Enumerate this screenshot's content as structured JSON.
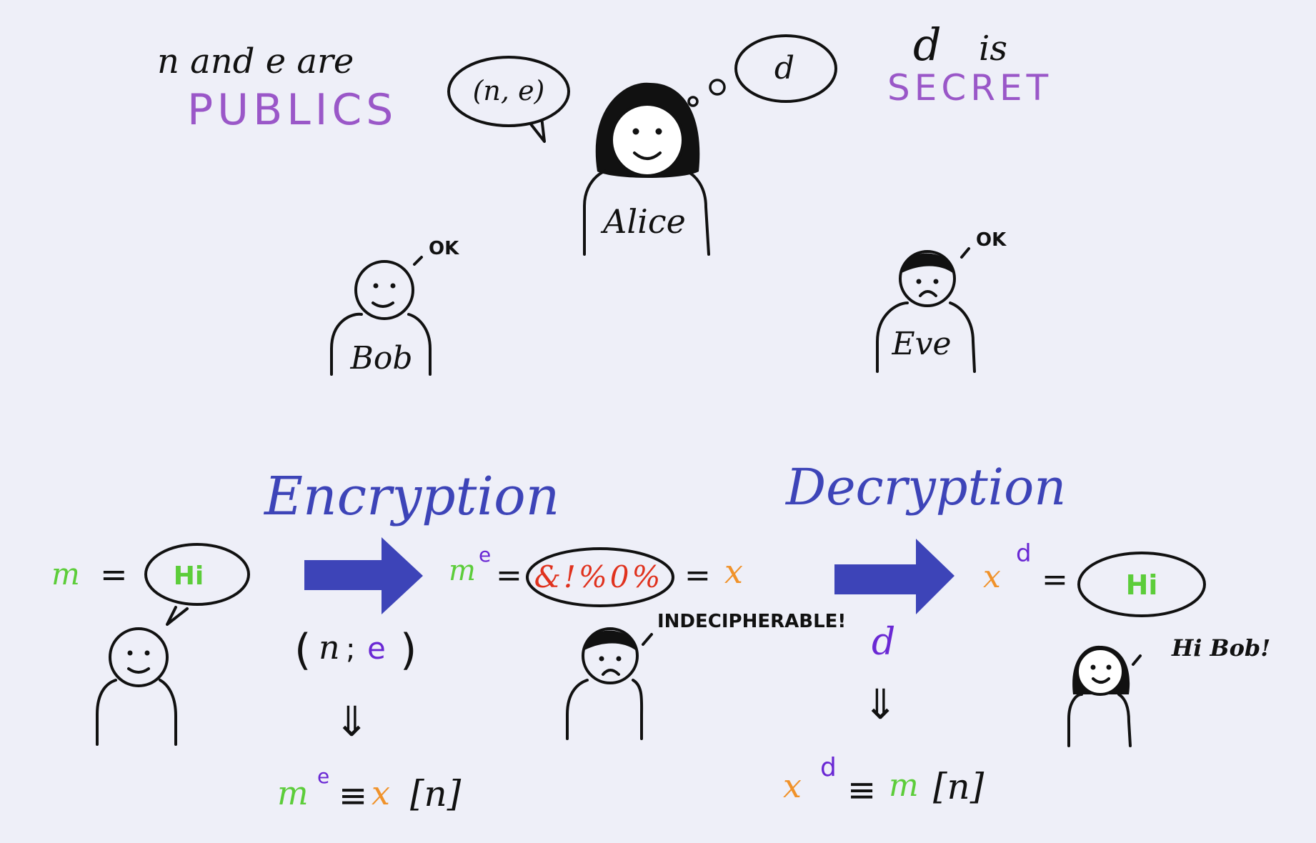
{
  "colors": {
    "ink": "#111111",
    "purple": "#9a57c8",
    "blue": "#3d44b8",
    "green": "#5ccd3a",
    "orange": "#f0922a",
    "red": "#e0321e",
    "violet": "#6a28d4",
    "background": "#eeeff8"
  },
  "top": {
    "public_line1": "n and e are",
    "public_line2": "PUBLICS",
    "secret_d": "d",
    "secret_is": "is",
    "secret_line2": "SECRET",
    "speech_bubble": "(n, e)",
    "thought_bubble": "d",
    "alice_label": "Alice",
    "bob_label": "Bob",
    "bob_reply": "OK",
    "eve_label": "Eve",
    "eve_reply": "OK"
  },
  "encryption": {
    "title": "Encryption",
    "m_label": "m",
    "equals": "=",
    "message": "Hi",
    "key_open": "(",
    "key_n": "n",
    "key_sep": ";",
    "key_e": "e",
    "key_close": ")",
    "implies": "⇓",
    "formula_m": "m",
    "formula_exp": "e",
    "formula_equiv": "≡",
    "formula_x": "x",
    "formula_mod": "[n]"
  },
  "cipher": {
    "m": "m",
    "exp": "e",
    "equals": "=",
    "scrambled": "&!%0%",
    "equals2": "=",
    "x": "x",
    "eve_comment": "INDECIPHERABLE!"
  },
  "decryption": {
    "title": "Decryption",
    "key": "d",
    "implies": "⇓",
    "x": "x",
    "exp": "d",
    "equals": "=",
    "message": "Hi",
    "alice_comment": "Hi Bob!",
    "formula_x": "x",
    "formula_exp": "d",
    "formula_equiv": "≡",
    "formula_m": "m",
    "formula_mod": "[n]"
  },
  "icons": {
    "arrow_encrypt": "right-arrow-icon",
    "arrow_decrypt": "right-arrow-icon"
  }
}
